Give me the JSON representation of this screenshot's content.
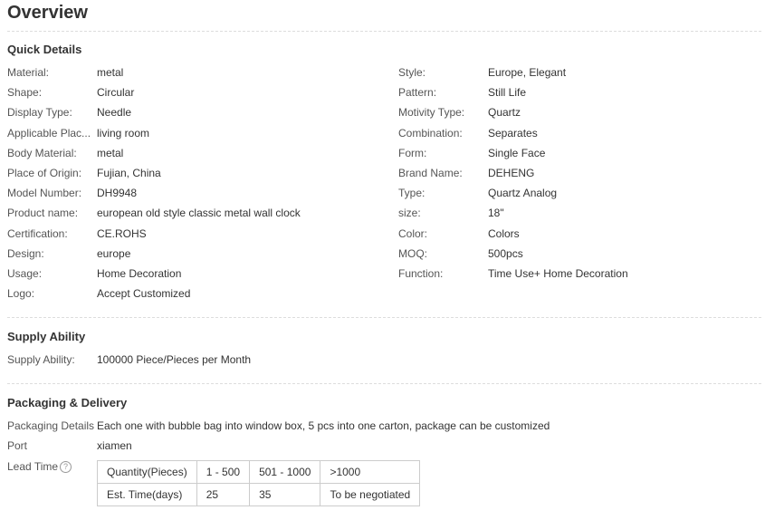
{
  "overview": {
    "title": "Overview"
  },
  "quick_details": {
    "title": "Quick Details",
    "left": [
      {
        "label": "Material:",
        "value": "metal"
      },
      {
        "label": "Shape:",
        "value": "Circular"
      },
      {
        "label": "Display Type:",
        "value": "Needle"
      },
      {
        "label": "Applicable Plac...",
        "value": "living room"
      },
      {
        "label": "Body Material:",
        "value": "metal"
      },
      {
        "label": "Place of Origin:",
        "value": "Fujian, China"
      },
      {
        "label": "Model Number:",
        "value": "DH9948"
      },
      {
        "label": "Product name:",
        "value": "european old style classic metal wall clock"
      },
      {
        "label": "Certification:",
        "value": "CE.ROHS"
      },
      {
        "label": "Design:",
        "value": "europe"
      },
      {
        "label": "Usage:",
        "value": "Home Decoration"
      },
      {
        "label": "Logo:",
        "value": "Accept Customized"
      }
    ],
    "right": [
      {
        "label": "Style:",
        "value": "Europe, Elegant"
      },
      {
        "label": "Pattern:",
        "value": "Still Life"
      },
      {
        "label": "Motivity Type:",
        "value": "Quartz"
      },
      {
        "label": "Combination:",
        "value": "Separates"
      },
      {
        "label": "Form:",
        "value": "Single Face"
      },
      {
        "label": "Brand Name:",
        "value": "DEHENG"
      },
      {
        "label": "Type:",
        "value": "Quartz Analog"
      },
      {
        "label": "size:",
        "value": "18\""
      },
      {
        "label": "Color:",
        "value": "Colors"
      },
      {
        "label": "MOQ:",
        "value": "500pcs"
      },
      {
        "label": "Function:",
        "value": "Time Use+ Home Decoration"
      }
    ]
  },
  "supply_ability": {
    "title": "Supply Ability",
    "label": "Supply Ability:",
    "value": "100000 Piece/Pieces per Month"
  },
  "packaging": {
    "title": "Packaging & Delivery",
    "details_label": "Packaging Details",
    "details_value": "Each one with bubble bag into window box, 5 pcs into one carton, package can be customized",
    "port_label": "Port",
    "port_value": "xiamen",
    "lead_time_label": "Lead Time",
    "lead_time_help_icon": "question-circle-icon",
    "lead_table": {
      "header": [
        "Quantity(Pieces)",
        "1 - 500",
        "501 - 1000",
        ">1000"
      ],
      "row": [
        "Est. Time(days)",
        "25",
        "35",
        "To be negotiated"
      ]
    }
  }
}
